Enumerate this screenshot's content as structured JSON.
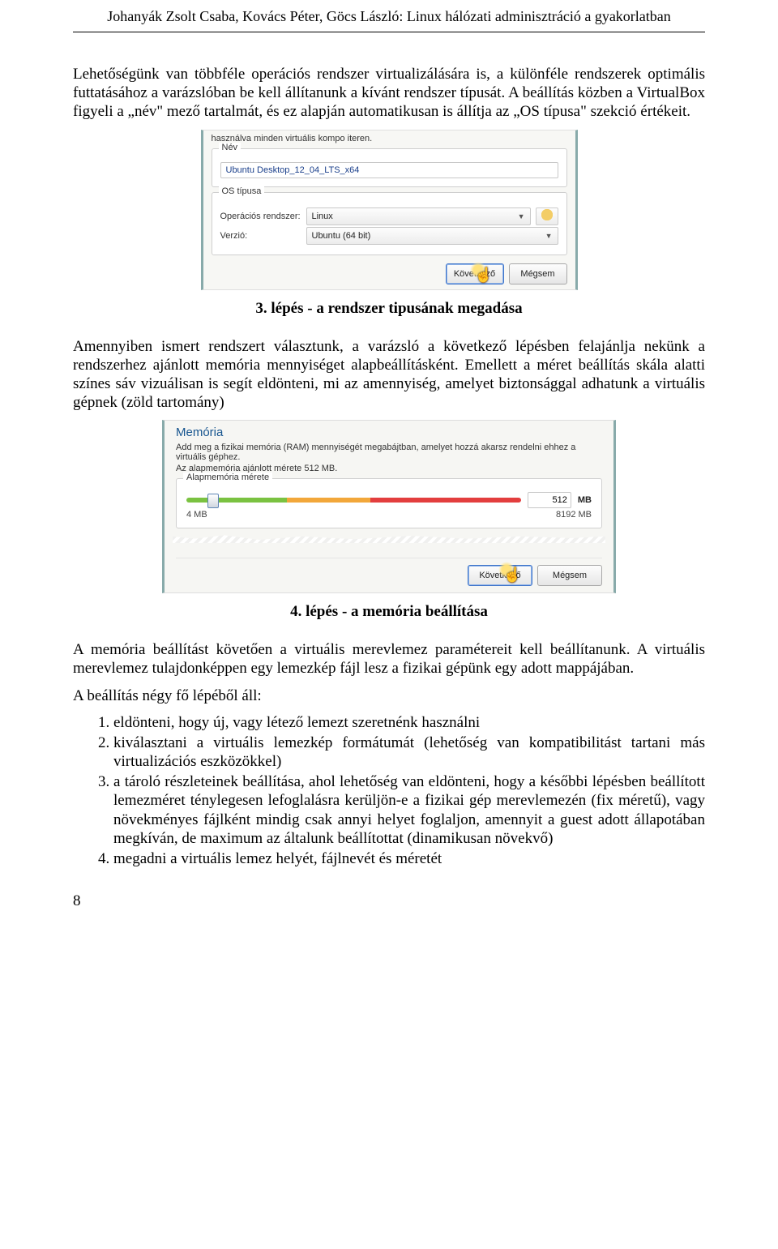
{
  "header": "Johanyák Zsolt Csaba, Kovács Péter, Göcs László: Linux hálózati adminisztráció a gyakorlatban",
  "page_number": "8",
  "para1": "Lehetőségünk van többféle operációs rendszer virtualizálására is, a különféle rendszerek optimális futtatásához a varázslóban be kell állítanunk a kívánt rendszer típusát. A beállítás közben a VirtualBox figyeli a „név\" mező tartalmát, és ez alapján automatikusan is állítja az „OS típusa\" szekció értékeit.",
  "shot1": {
    "top_hint": "használva minden virtuális kompo iteren.",
    "group_name_legend": "Név",
    "name_value": "Ubuntu Desktop_12_04_LTS_x64",
    "group_os_legend": "OS típusa",
    "os_label": "Operációs rendszer:",
    "os_value": "Linux",
    "ver_label": "Verzió:",
    "ver_value": "Ubuntu (64 bit)",
    "btn_next": "Következő",
    "btn_cancel": "Mégsem"
  },
  "caption1": "3. lépés - a rendszer tipusának megadása",
  "para2": "Amennyiben ismert rendszert választunk, a varázsló a következő lépésben felajánlja nekünk a rendszerhez ajánlott memória mennyiséget alapbeállításként. Emellett a méret beállítás skála alatti színes sáv vizuálisan is segít eldönteni, mi az amennyiség, amelyet biztonsággal adhatunk a virtuális gépnek (zöld tartomány)",
  "shot2": {
    "title": "Memória",
    "desc1": "Add meg a fizikai memória (RAM) mennyiségét megabájtban, amelyet hozzá akarsz rendelni ehhez a virtuális géphez.",
    "desc2": "Az alapmemória ajánlott mérete 512 MB.",
    "group_mem_legend": "Alapmemória mérete",
    "min_tick": "4 MB",
    "max_tick": "8192 MB",
    "value": "512",
    "unit": "MB",
    "btn_next": "Következő",
    "btn_cancel": "Mégsem"
  },
  "caption2": "4. lépés - a memória beállítása",
  "para3": "A memória beállítást követően a virtuális merevlemez paramétereit kell beállítanunk. A virtuális merevlemez tulajdonképpen egy lemezkép fájl lesz a fizikai gépünk egy adott mappájában.",
  "para4": "A beállítás négy fő lépéből áll:",
  "list": {
    "i1": "eldönteni, hogy új, vagy létező lemezt szeretnénk használni",
    "i2": "kiválasztani a virtuális lemezkép formátumát (lehetőség van kompatibilitást tartani más virtualizációs eszközökkel)",
    "i3": "a tároló részleteinek beállítása, ahol lehetőség van eldönteni, hogy a későbbi lépésben beállított lemezméret ténylegesen lefoglalásra kerüljön-e a fizikai gép merevlemezén (fix méretű), vagy növekményes fájlként mindig csak annyi helyet foglaljon, amennyit a guest adott állapotában megkíván, de maximum az általunk beállítottat (dinamikusan növekvő)",
    "i4": "megadni a virtuális lemez helyét, fájlnevét és méretét"
  }
}
